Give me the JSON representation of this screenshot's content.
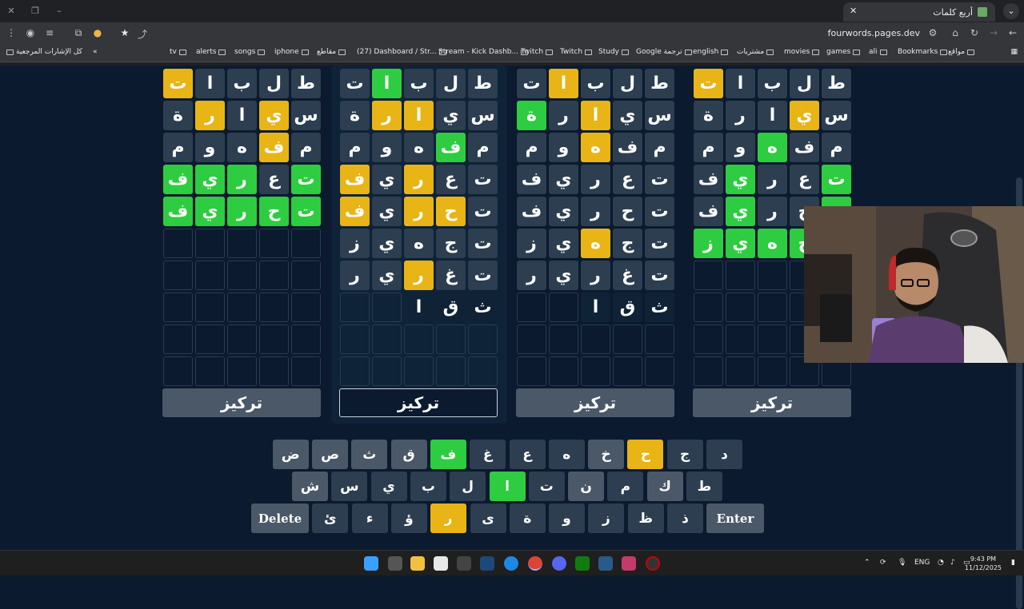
{
  "browser": {
    "tab_title": "أربع كلمات",
    "url": "fourwords.pages.dev",
    "bookmarks": [
      "Bookmarks",
      "مواقع",
      "ali",
      "games",
      "movies",
      "مشتريات",
      "english",
      "Google ترجمة",
      "Study",
      "Twitch",
      "Twitch",
      "Stream - Kick Dashb...",
      "(27) Dashboard / Str...",
      "مقاطع",
      "iphone",
      "songs",
      "alerts",
      "tv"
    ],
    "all_bookmarks": "كل الإشارات المرجعية"
  },
  "boards": [
    {
      "rows": [
        [
          [
            "ت",
            "y"
          ],
          [
            "ا",
            "g"
          ],
          [
            "ب",
            "g"
          ],
          [
            "ل",
            "g"
          ],
          [
            "ط",
            "g"
          ]
        ],
        [
          [
            "ة",
            "g"
          ],
          [
            "ر",
            "y"
          ],
          [
            "ا",
            "g"
          ],
          [
            "ي",
            "y"
          ],
          [
            "س",
            "g"
          ]
        ],
        [
          [
            "م",
            "g"
          ],
          [
            "و",
            "g"
          ],
          [
            "ه",
            "g"
          ],
          [
            "ف",
            "y"
          ],
          [
            "م",
            "g"
          ]
        ],
        [
          [
            "ف",
            "G"
          ],
          [
            "ي",
            "G"
          ],
          [
            "ر",
            "G"
          ],
          [
            "ع",
            "g"
          ],
          [
            "ت",
            "G"
          ]
        ],
        [
          [
            "ف",
            "G"
          ],
          [
            "ي",
            "G"
          ],
          [
            "ر",
            "G"
          ],
          [
            "ح",
            "G"
          ],
          [
            "ت",
            "G"
          ]
        ]
      ],
      "focus_label": "تركيز"
    },
    {
      "rows": [
        [
          [
            "ت",
            "g"
          ],
          [
            "ا",
            "G"
          ],
          [
            "ب",
            "g"
          ],
          [
            "ل",
            "g"
          ],
          [
            "ط",
            "g"
          ]
        ],
        [
          [
            "ة",
            "g"
          ],
          [
            "ر",
            "y"
          ],
          [
            "ا",
            "y"
          ],
          [
            "ي",
            "g"
          ],
          [
            "س",
            "g"
          ]
        ],
        [
          [
            "م",
            "g"
          ],
          [
            "و",
            "g"
          ],
          [
            "ه",
            "g"
          ],
          [
            "ف",
            "G"
          ],
          [
            "م",
            "g"
          ]
        ],
        [
          [
            "ف",
            "y"
          ],
          [
            "ي",
            "g"
          ],
          [
            "ر",
            "y"
          ],
          [
            "ع",
            "g"
          ],
          [
            "ت",
            "g"
          ]
        ],
        [
          [
            "ف",
            "y"
          ],
          [
            "ي",
            "g"
          ],
          [
            "ر",
            "y"
          ],
          [
            "ح",
            "y"
          ],
          [
            "ت",
            "g"
          ]
        ],
        [
          [
            "ز",
            "g"
          ],
          [
            "ي",
            "g"
          ],
          [
            "ه",
            "g"
          ],
          [
            "ج",
            "g"
          ],
          [
            "ت",
            "g"
          ]
        ],
        [
          [
            "ر",
            "g"
          ],
          [
            "ي",
            "g"
          ],
          [
            "ر",
            "y"
          ],
          [
            "غ",
            "g"
          ],
          [
            "ت",
            "g"
          ]
        ],
        [
          [
            "",
            "e"
          ],
          [
            "",
            "e"
          ],
          [
            "ا",
            "n"
          ],
          [
            "ق",
            "n"
          ],
          [
            "ث",
            "n"
          ]
        ]
      ],
      "focus_label": "تركيز"
    },
    {
      "rows": [
        [
          [
            "ت",
            "g"
          ],
          [
            "ا",
            "y"
          ],
          [
            "ب",
            "g"
          ],
          [
            "ل",
            "g"
          ],
          [
            "ط",
            "g"
          ]
        ],
        [
          [
            "ة",
            "G"
          ],
          [
            "ر",
            "g"
          ],
          [
            "ا",
            "y"
          ],
          [
            "ي",
            "g"
          ],
          [
            "س",
            "g"
          ]
        ],
        [
          [
            "م",
            "g"
          ],
          [
            "و",
            "g"
          ],
          [
            "ه",
            "y"
          ],
          [
            "ف",
            "g"
          ],
          [
            "م",
            "g"
          ]
        ],
        [
          [
            "ف",
            "g"
          ],
          [
            "ي",
            "g"
          ],
          [
            "ر",
            "g"
          ],
          [
            "ع",
            "g"
          ],
          [
            "ت",
            "g"
          ]
        ],
        [
          [
            "ف",
            "g"
          ],
          [
            "ي",
            "g"
          ],
          [
            "ر",
            "g"
          ],
          [
            "ح",
            "g"
          ],
          [
            "ت",
            "g"
          ]
        ],
        [
          [
            "ز",
            "g"
          ],
          [
            "ي",
            "g"
          ],
          [
            "ه",
            "y"
          ],
          [
            "ج",
            "g"
          ],
          [
            "ت",
            "g"
          ]
        ],
        [
          [
            "ر",
            "g"
          ],
          [
            "ي",
            "g"
          ],
          [
            "ر",
            "g"
          ],
          [
            "غ",
            "g"
          ],
          [
            "ت",
            "g"
          ]
        ],
        [
          [
            "",
            "e"
          ],
          [
            "",
            "e"
          ],
          [
            "ا",
            "n"
          ],
          [
            "ق",
            "n"
          ],
          [
            "ث",
            "n"
          ]
        ]
      ],
      "focus_label": "تركيز"
    },
    {
      "rows": [
        [
          [
            "ت",
            "y"
          ],
          [
            "ا",
            "g"
          ],
          [
            "ب",
            "g"
          ],
          [
            "ل",
            "g"
          ],
          [
            "ط",
            "g"
          ]
        ],
        [
          [
            "ة",
            "g"
          ],
          [
            "ر",
            "g"
          ],
          [
            "ا",
            "g"
          ],
          [
            "ي",
            "y"
          ],
          [
            "س",
            "g"
          ]
        ],
        [
          [
            "م",
            "g"
          ],
          [
            "و",
            "g"
          ],
          [
            "ه",
            "G"
          ],
          [
            "ف",
            "g"
          ],
          [
            "م",
            "g"
          ]
        ],
        [
          [
            "ف",
            "g"
          ],
          [
            "ي",
            "G"
          ],
          [
            "ر",
            "g"
          ],
          [
            "ع",
            "g"
          ],
          [
            "ت",
            "G"
          ]
        ],
        [
          [
            "ف",
            "g"
          ],
          [
            "ي",
            "G"
          ],
          [
            "ر",
            "g"
          ],
          [
            "ح",
            "g"
          ],
          [
            "ت",
            "G"
          ]
        ],
        [
          [
            "ز",
            "G"
          ],
          [
            "ي",
            "G"
          ],
          [
            "ه",
            "G"
          ],
          [
            "ج",
            "G"
          ],
          [
            "",
            "e"
          ]
        ]
      ],
      "focus_label": "تركيز"
    }
  ],
  "keyboard": {
    "row1": [
      [
        "د",
        "g"
      ],
      [
        "ج",
        "g"
      ],
      [
        "ح",
        "y"
      ],
      [
        "خ",
        "l"
      ],
      [
        "ه",
        "g"
      ],
      [
        "ع",
        "g"
      ],
      [
        "غ",
        "g"
      ],
      [
        "ف",
        "G"
      ],
      [
        "ق",
        "l"
      ],
      [
        "ث",
        "l"
      ],
      [
        "ص",
        "l"
      ],
      [
        "ض",
        "l"
      ]
    ],
    "row2": [
      [
        "ط",
        "g"
      ],
      [
        "ك",
        "l"
      ],
      [
        "م",
        "g"
      ],
      [
        "ن",
        "l"
      ],
      [
        "ت",
        "g"
      ],
      [
        "ا",
        "G"
      ],
      [
        "ل",
        "g"
      ],
      [
        "ب",
        "g"
      ],
      [
        "ي",
        "g"
      ],
      [
        "س",
        "g"
      ],
      [
        "ش",
        "l"
      ]
    ],
    "row3": [
      [
        "ذ",
        "g"
      ],
      [
        "ظ",
        "g"
      ],
      [
        "ز",
        "g"
      ],
      [
        "و",
        "g"
      ],
      [
        "ة",
        "g"
      ],
      [
        "ى",
        "g"
      ],
      [
        "ر",
        "y"
      ],
      [
        "ؤ",
        "g"
      ],
      [
        "ء",
        "g"
      ],
      [
        "ئ",
        "g"
      ]
    ],
    "enter_label": "Enter",
    "delete_label": "Delete"
  },
  "taskbar": {
    "lang": "ENG",
    "time": "9:43 PM",
    "date": "11/12/2025"
  },
  "colors": {
    "green": "#2ecc40",
    "yellow": "#e8b416",
    "grey": "#2c3e50",
    "background": "#0b1a2e"
  }
}
